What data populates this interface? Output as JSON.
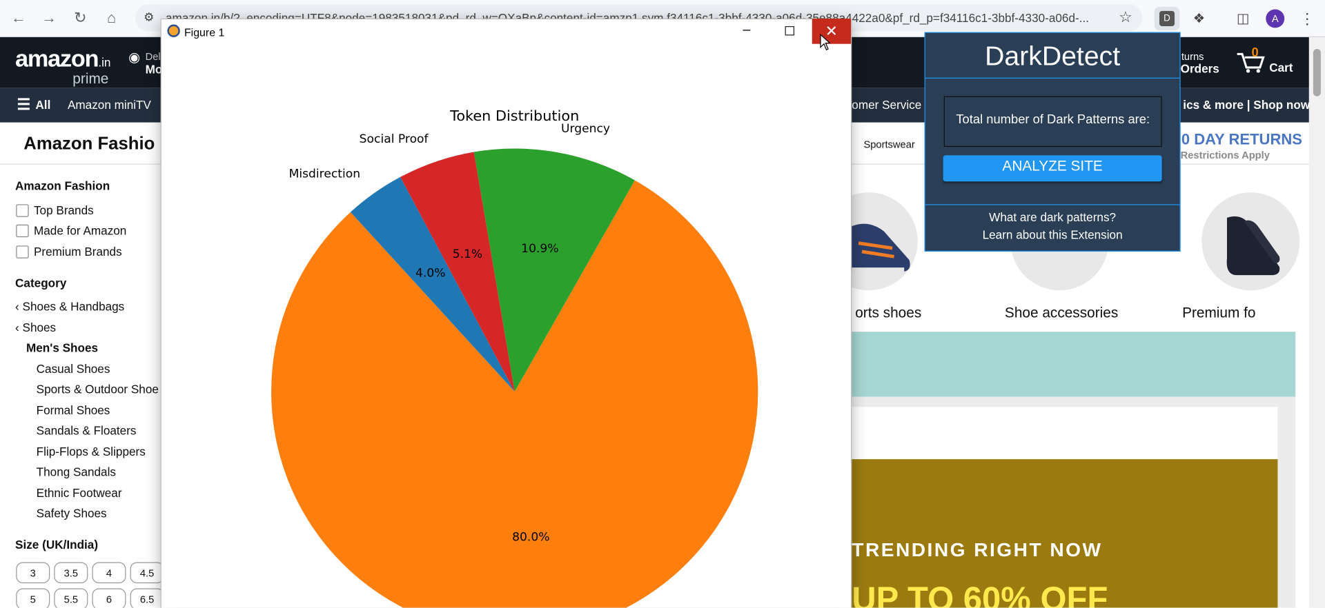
{
  "browser": {
    "url": "amazon.in/b/?_encoding=UTF8&node=1983518031&pd_rd_w=QXaBp&content-id=amzn1.sym.f34116c1-3bbf-4330-a06d-35e88a4422a0&pf_rd_p=f34116c1-3bbf-4330-a06d-...",
    "profile_initial": "A",
    "ext_letter": "D"
  },
  "amazon": {
    "logo_main": "amazon",
    "logo_in": ".in",
    "logo_prime": "prime",
    "deliver_line1": "Del",
    "deliver_line2": "Mo",
    "returns_line1": "turns",
    "returns_line2": "Orders",
    "cart_count": "0",
    "cart_label": "Cart",
    "nav_all": "All",
    "nav_minitv": "Amazon miniTV",
    "nav_customer": "omer Service",
    "nav_right": "ics & more | Shop now",
    "page_title": "Amazon Fashio",
    "sportswear": "Sportswear",
    "day_returns": "0 DAY RETURNS",
    "restrictions": "Restrictions Apply"
  },
  "sidebar": {
    "section1": "Amazon Fashion",
    "checks": [
      "Top Brands",
      "Made for Amazon",
      "Premium Brands"
    ],
    "category_heading": "Category",
    "back_links": [
      "Shoes & Handbags",
      "Shoes"
    ],
    "current": "Men's Shoes",
    "subcats": [
      "Casual Shoes",
      "Sports & Outdoor Shoe",
      "Formal Shoes",
      "Sandals & Floaters",
      "Flip-Flops & Slippers",
      "Thong Sandals",
      "Ethnic Footwear",
      "Safety Shoes"
    ],
    "size_heading": "Size (UK/India)",
    "sizes": [
      "3",
      "3.5",
      "4",
      "4.5",
      "5",
      "5.5",
      "6",
      "6.5"
    ]
  },
  "tiles": [
    "orts shoes",
    "Shoe accessories",
    "Premium fo"
  ],
  "banner": {
    "trending": "TRENDING RIGHT NOW",
    "offer": "UP TO 60% OFF"
  },
  "figure": {
    "title": "Figure 1"
  },
  "chart_data": {
    "type": "pie",
    "title": "Token Distribution",
    "slices": [
      {
        "label": "Misdirection",
        "value": 4.0,
        "pct_text": "4.0%",
        "color": "#1f77b4"
      },
      {
        "label": "",
        "value": 80.0,
        "pct_text": "80.0%",
        "color": "#ff7f0e"
      },
      {
        "label": "Urgency",
        "value": 10.9,
        "pct_text": "10.9%",
        "color": "#2ca02c"
      },
      {
        "label": "Social Proof",
        "value": 5.1,
        "pct_text": "5.1%",
        "color": "#d62728"
      }
    ]
  },
  "darkdetect": {
    "title": "DarkDetect",
    "count_text": "Total number of Dark Patterns are:",
    "analyze_label": "ANALYZE SITE",
    "link1": "What are dark patterns?",
    "link2": "Learn about this Extension"
  }
}
